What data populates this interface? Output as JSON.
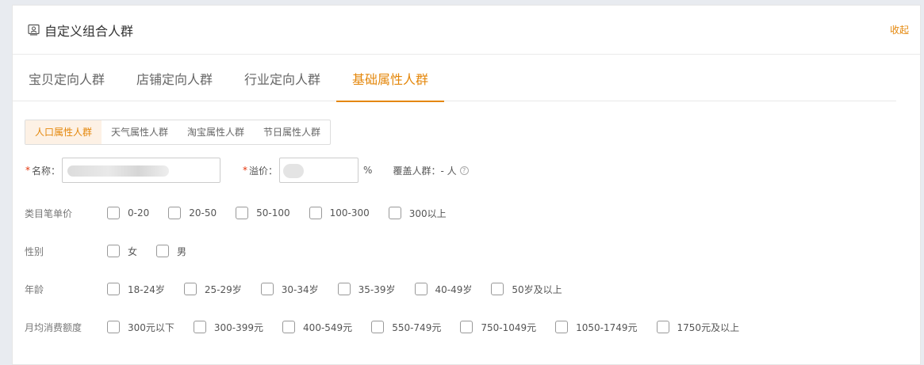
{
  "header": {
    "title": "自定义组合人群",
    "collapse_label": "收起"
  },
  "tabs": [
    {
      "label": "宝贝定向人群",
      "active": false
    },
    {
      "label": "店铺定向人群",
      "active": false
    },
    {
      "label": "行业定向人群",
      "active": false
    },
    {
      "label": "基础属性人群",
      "active": true
    }
  ],
  "subtabs": [
    {
      "label": "人口属性人群",
      "active": true
    },
    {
      "label": "天气属性人群",
      "active": false
    },
    {
      "label": "淘宝属性人群",
      "active": false
    },
    {
      "label": "节日属性人群",
      "active": false
    }
  ],
  "form": {
    "required_mark": "*",
    "name_label": "名称：",
    "premium_label": "溢价：",
    "premium_unit": "%",
    "coverage_label": "覆盖人群：",
    "coverage_value": "- 人",
    "help_glyph": "?"
  },
  "filters": {
    "price": {
      "label": "类目笔单价",
      "options": [
        "0-20",
        "20-50",
        "50-100",
        "100-300",
        "300以上"
      ]
    },
    "gender": {
      "label": "性别",
      "options": [
        "女",
        "男"
      ]
    },
    "age": {
      "label": "年龄",
      "options": [
        "18-24岁",
        "25-29岁",
        "30-34岁",
        "35-39岁",
        "40-49岁",
        "50岁及以上"
      ]
    },
    "spend": {
      "label": "月均消费额度",
      "options": [
        "300元以下",
        "300-399元",
        "400-549元",
        "550-749元",
        "750-1049元",
        "1050-1749元",
        "1750元及以上"
      ]
    }
  },
  "colors": {
    "accent": "#e4870b",
    "required": "#e4350b"
  }
}
